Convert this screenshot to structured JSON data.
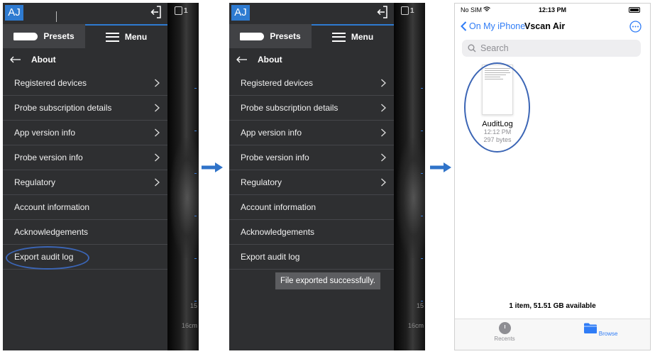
{
  "android": {
    "avatar": "AJ",
    "frame_count": "1",
    "tabs": {
      "presets": "Presets",
      "menu": "Menu"
    },
    "about": "About",
    "items": [
      {
        "label": "Registered devices",
        "chevron": true
      },
      {
        "label": "Probe subscription details",
        "chevron": true
      },
      {
        "label": "App version info",
        "chevron": true
      },
      {
        "label": "Probe version info",
        "chevron": true
      },
      {
        "label": "Regulatory",
        "chevron": true
      },
      {
        "label": "Account information",
        "chevron": false
      },
      {
        "label": "Acknowledgements",
        "chevron": false
      },
      {
        "label": "Export audit log",
        "chevron": false
      }
    ],
    "depth_value": "15",
    "depth_unit": "16cm",
    "toast": "File exported successfully.",
    "accent_color": "#2e7bd1"
  },
  "ios": {
    "carrier": "No SIM",
    "time": "12:13 PM",
    "back_label": "On My iPhone",
    "title": "Vscan Air",
    "search_placeholder": "Search",
    "file": {
      "name": "AuditLog",
      "time": "12:12 PM",
      "size": "297 bytes"
    },
    "storage": "1 item, 51.51 GB available",
    "tabs": {
      "recents": "Recents",
      "browse": "Browse"
    },
    "accent_color": "#2f7cf6"
  },
  "icons": [
    "logout-icon",
    "probe-icon",
    "hamburger-icon",
    "back-arrow-icon",
    "chevron-right-icon",
    "wifi-icon",
    "battery-icon",
    "more-icon",
    "search-icon",
    "clock-icon",
    "folder-icon",
    "flow-arrow-icon"
  ]
}
